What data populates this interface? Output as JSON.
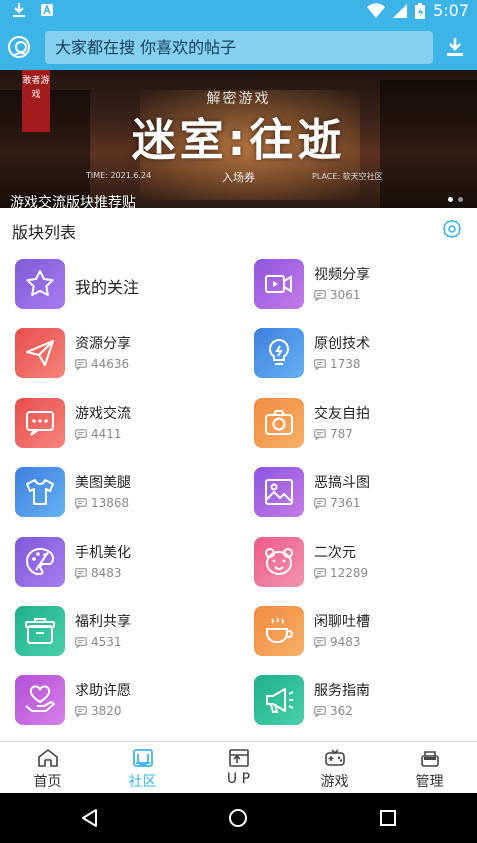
{
  "status_bar": {
    "time": "5:07"
  },
  "search": {
    "placeholder": "大家都在搜  你喜欢的帖子"
  },
  "banner": {
    "tag": "敢者游戏",
    "subtitle": "解密游戏",
    "title": "迷室:往逝",
    "time": "TIME: 2021.6.24",
    "ticket": "入场券",
    "place": "PLACE: 软天空社区",
    "caption": "游戏交流版块推荐贴"
  },
  "section": {
    "title": "版块列表"
  },
  "boards": [
    {
      "name": "我的关注",
      "count": "",
      "icon": "star-icon",
      "color_from": "#7e5bd8",
      "color_to": "#a97cf0"
    },
    {
      "name": "视频分享",
      "count": "3061",
      "icon": "video-icon",
      "color_from": "#8e55e0",
      "color_to": "#c47be6"
    },
    {
      "name": "资源分享",
      "count": "44636",
      "icon": "paper-plane-icon",
      "color_from": "#e84d4d",
      "color_to": "#f5857a"
    },
    {
      "name": "原创技术",
      "count": "1738",
      "icon": "lightbulb-icon",
      "color_from": "#3f7fe0",
      "color_to": "#63b2f2"
    },
    {
      "name": "游戏交流",
      "count": "4411",
      "icon": "chat-icon",
      "color_from": "#e84d4d",
      "color_to": "#f5857a"
    },
    {
      "name": "交友自拍",
      "count": "787",
      "icon": "camera-icon",
      "color_from": "#f08a3e",
      "color_to": "#f6b168"
    },
    {
      "name": "美图美腿",
      "count": "13868",
      "icon": "tshirt-icon",
      "color_from": "#3f7fe0",
      "color_to": "#63b2f2"
    },
    {
      "name": "恶搞斗图",
      "count": "7361",
      "icon": "image-icon",
      "color_from": "#8e55e0",
      "color_to": "#c47be6"
    },
    {
      "name": "手机美化",
      "count": "8483",
      "icon": "palette-icon",
      "color_from": "#7e5bd8",
      "color_to": "#a97cf0"
    },
    {
      "name": "二次元",
      "count": "12289",
      "icon": "bear-icon",
      "color_from": "#ec5a8a",
      "color_to": "#f394b1"
    },
    {
      "name": "福利共享",
      "count": "4531",
      "icon": "gift-box-icon",
      "color_from": "#1faf8c",
      "color_to": "#48d1ab"
    },
    {
      "name": "闲聊吐槽",
      "count": "9483",
      "icon": "coffee-icon",
      "color_from": "#f08a3e",
      "color_to": "#f6b168"
    },
    {
      "name": "求助许愿",
      "count": "3820",
      "icon": "heart-hand-icon",
      "color_from": "#b34fd6",
      "color_to": "#d680e8"
    },
    {
      "name": "服务指南",
      "count": "362",
      "icon": "megaphone-icon",
      "color_from": "#1faf8c",
      "color_to": "#48d1ab"
    }
  ],
  "bottom_nav": [
    {
      "label": "首页",
      "icon": "home-icon"
    },
    {
      "label": "社区",
      "icon": "community-icon",
      "active": true
    },
    {
      "label": "U P",
      "icon": "up-icon"
    },
    {
      "label": "游戏",
      "icon": "gamepad-icon"
    },
    {
      "label": "管理",
      "icon": "manage-icon"
    }
  ],
  "colors": {
    "accent": "#3db4e8",
    "search_bg": "#84d0f0"
  }
}
